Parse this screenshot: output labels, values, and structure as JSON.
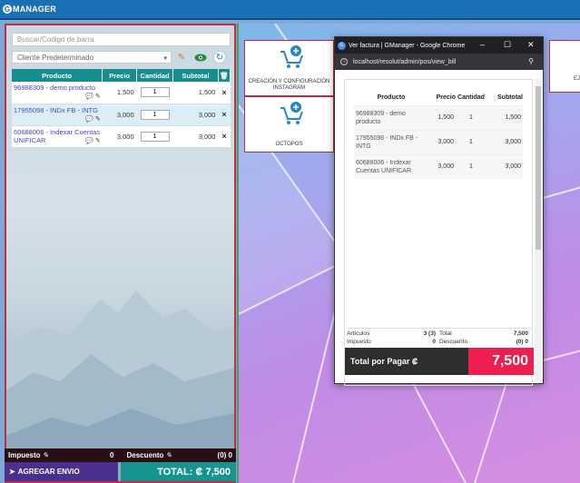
{
  "app": {
    "logo_letter": "G",
    "logo_text": "MANAGER"
  },
  "pos": {
    "search_placeholder": "Buscar/Codigo de barra",
    "client": "Cliente Predeterminado",
    "columns": {
      "product": "Producto",
      "price": "Precio",
      "qty": "Cantidad",
      "subtotal": "Subtotal"
    },
    "rows": [
      {
        "product": "96988309 - demo producto",
        "price": "1,500",
        "qty": "1",
        "subtotal": "1,500"
      },
      {
        "product": "17955098 - INDx FB - INTG",
        "price": "3,000",
        "qty": "1",
        "subtotal": "3,000"
      },
      {
        "product": "60688006 - Indexar Cuentas UNIFICAR",
        "price": "3,000",
        "qty": "1",
        "subtotal": "3,000"
      }
    ],
    "tax_label": "Impuesto",
    "tax_value": "0",
    "discount_label": "Descuento",
    "discount_value": "(0) 0",
    "send_label": "AGREGAR ENVIO",
    "total_label": "TOTAL: ₡ 7,500"
  },
  "tiles": [
    {
      "label": "CREACIÓN Y CONFIGURACIÓN INSTAGRAM"
    },
    {
      "label": "OCTOPOS"
    },
    {
      "label": "EJ"
    }
  ],
  "popup": {
    "title": "Ver factura | GManager - Google Chrome",
    "url": "localhost/resolut/admin/pos/view_bill",
    "columns": {
      "product": "Producto",
      "price": "Precio",
      "qty": "Cantidad",
      "subtotal": "Subtotal"
    },
    "rows": [
      {
        "product": "96988309 - demo producto",
        "price": "1,500",
        "qty": "1",
        "subtotal": "1,500"
      },
      {
        "product": "17955098 - INDx FB - INTG",
        "price": "3,000",
        "qty": "1",
        "subtotal": "3,000"
      },
      {
        "product": "60688006 - Indexar Cuentas UNIFICAR",
        "price": "3,000",
        "qty": "1",
        "subtotal": "3,000"
      }
    ],
    "articles_label": "Artículos",
    "articles_value": "3 (3)",
    "total_label": "Total",
    "total_value": "7,500",
    "tax_label": "Impuesto",
    "tax_value": "0",
    "discount_label": "Descuento",
    "discount_value": "(0) 0",
    "pay_label": "Total por Pagar ₡",
    "pay_value": "7,500"
  },
  "colors": {
    "header": "#1b6fb3",
    "teal": "#168e8e",
    "danger": "#ee1e4f",
    "purple": "#4a2f8e"
  }
}
